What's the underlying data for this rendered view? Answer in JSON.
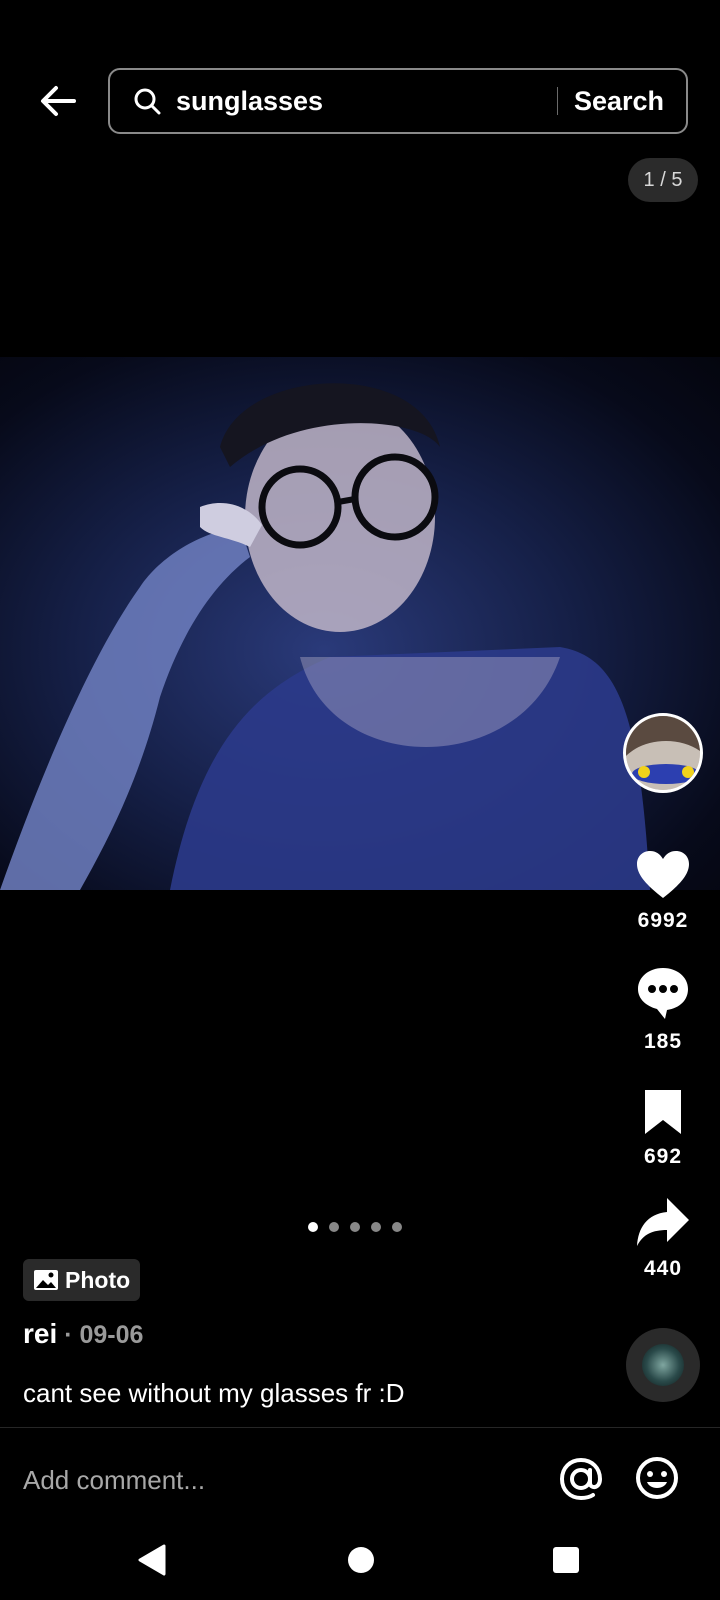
{
  "search": {
    "query": "sunglasses",
    "button_label": "Search"
  },
  "counter": "1 / 5",
  "actions": {
    "likes": "6992",
    "comments": "185",
    "saves": "692",
    "shares": "440"
  },
  "carousel": {
    "total": 5,
    "active": 1
  },
  "badge": {
    "label": "Photo"
  },
  "post": {
    "author": "rei",
    "separator": " · ",
    "date": "09-06",
    "caption": "cant see without my glasses fr :D"
  },
  "comment": {
    "placeholder": "Add comment..."
  },
  "icons": {
    "back": "arrow-left-icon",
    "search": "search-icon",
    "like": "heart-icon",
    "comment": "comment-icon",
    "save": "bookmark-icon",
    "share": "share-icon",
    "mention": "at-icon",
    "emoji": "emoji-icon"
  },
  "colors": {
    "background": "#000000",
    "badge": "#2a2a2a",
    "muted": "#9a9a9a"
  }
}
